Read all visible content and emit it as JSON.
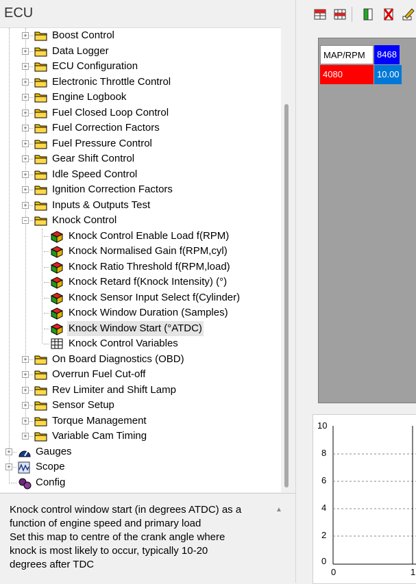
{
  "left_panel": {
    "title": "ECU"
  },
  "tree": {
    "nodes": [
      {
        "label": "Boost Control"
      },
      {
        "label": "Data Logger"
      },
      {
        "label": "ECU Configuration"
      },
      {
        "label": "Electronic Throttle Control"
      },
      {
        "label": "Engine Logbook"
      },
      {
        "label": "Fuel Closed Loop Control"
      },
      {
        "label": "Fuel Correction Factors"
      },
      {
        "label": "Fuel Pressure Control"
      },
      {
        "label": "Gear Shift Control"
      },
      {
        "label": "Idle Speed Control"
      },
      {
        "label": "Ignition Correction Factors"
      },
      {
        "label": "Inputs & Outputs Test"
      },
      {
        "label": "Knock Control"
      },
      {
        "label": "Knock Control Enable Load f(RPM)"
      },
      {
        "label": "Knock Normalised Gain f(RPM,cyl)"
      },
      {
        "label": "Knock Ratio Threshold f(RPM,load)"
      },
      {
        "label": "Knock Retard f(Knock Intensity) (°)"
      },
      {
        "label": "Knock Sensor Input Select f(Cylinder)"
      },
      {
        "label": "Knock Window Duration (Samples)"
      },
      {
        "label": "Knock Window Start (°ATDC)"
      },
      {
        "label": "Knock Control Variables"
      },
      {
        "label": "On Board Diagnostics (OBD)"
      },
      {
        "label": "Overrun Fuel Cut-off"
      },
      {
        "label": "Rev Limiter and Shift Lamp"
      },
      {
        "label": "Sensor Setup"
      },
      {
        "label": "Torque Management"
      },
      {
        "label": "Variable Cam Timing"
      },
      {
        "label": "Gauges"
      },
      {
        "label": "Scope"
      },
      {
        "label": "Config"
      }
    ]
  },
  "description": {
    "text_lines": [
      "Knock control window start (in degrees ATDC) as a",
      "function of engine speed and primary load",
      "Set this map to centre of the crank angle where",
      "knock is most likely to occur, typically 10-20",
      "degrees after TDC"
    ]
  },
  "map_table": {
    "header_label": "MAP/RPM",
    "rpm_value": "8468",
    "map_value": "4080",
    "cell_value": "10.00",
    "colors": {
      "rpm_bg": "#0000ff",
      "map_bg": "#ff0000",
      "cell_bg": "#0078d7"
    }
  },
  "graph": {
    "y_ticks": [
      "10",
      "8",
      "6",
      "4",
      "2",
      "0"
    ],
    "x_ticks": [
      "0",
      "1"
    ]
  },
  "toolbar_icons": [
    "insert-row-icon",
    "insert-grid-icon",
    "insert-column-icon",
    "delete-column-icon",
    "edit-pencil-icon"
  ]
}
